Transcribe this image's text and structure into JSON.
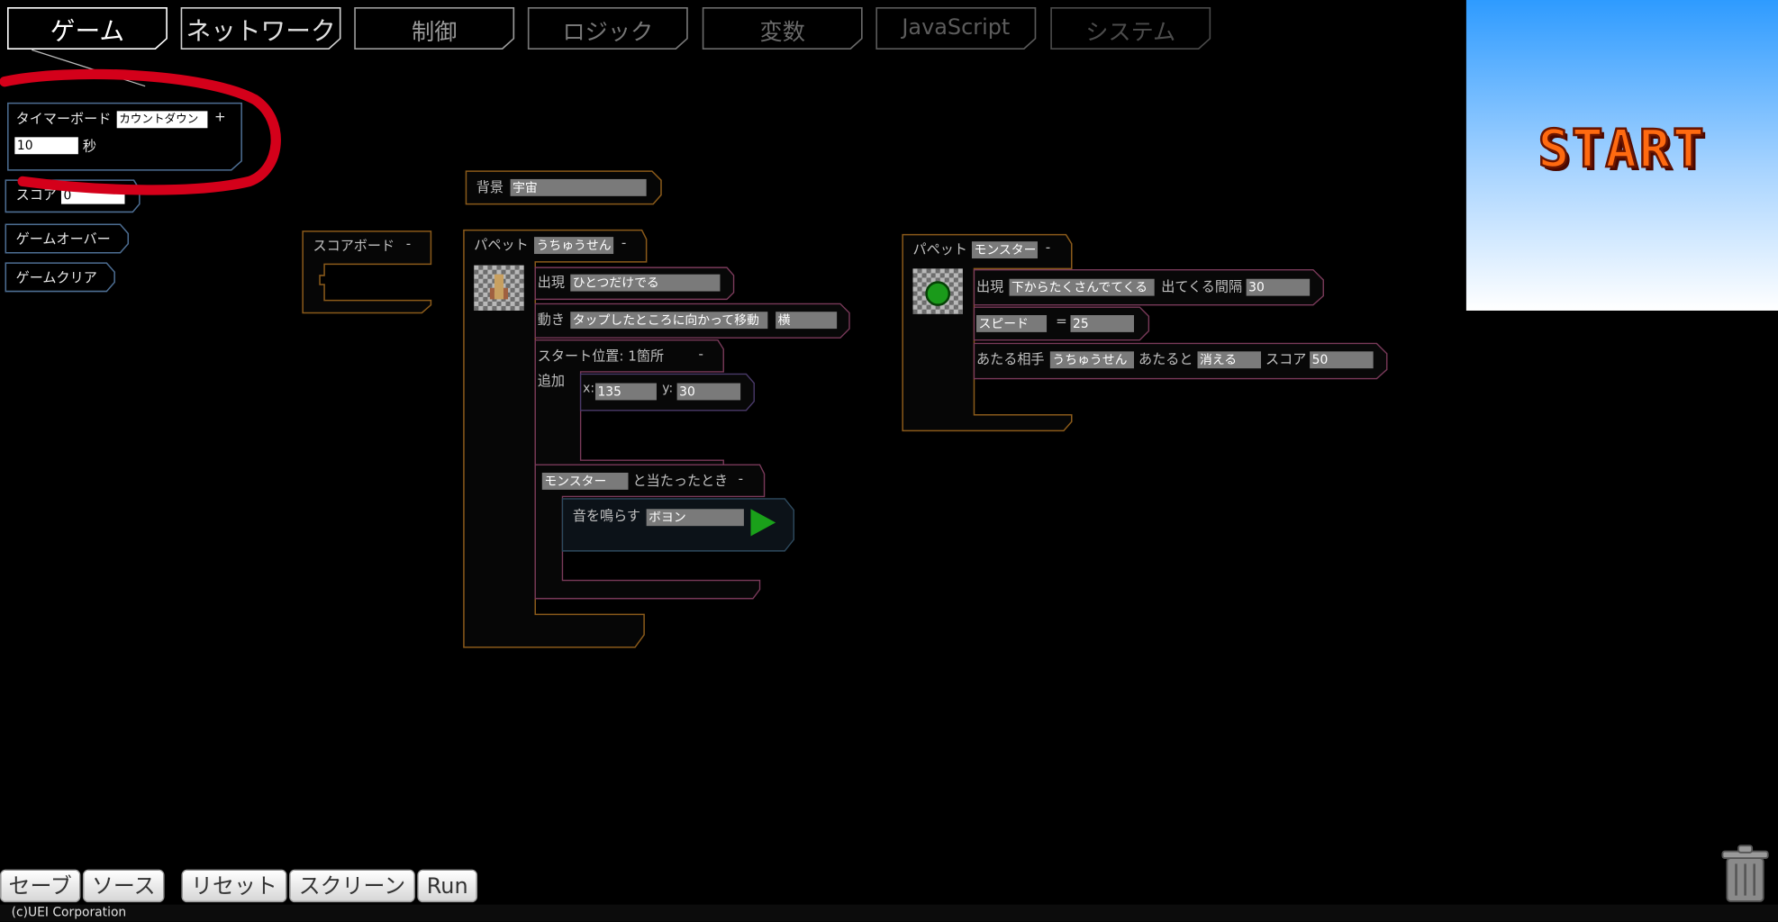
{
  "tabs": [
    "ゲーム",
    "ネットワーク",
    "制御",
    "ロジック",
    "変数",
    "JavaScript",
    "システム"
  ],
  "palette": {
    "timer": {
      "label": "タイマーボード",
      "mode": "カウントダウン",
      "plus": "+",
      "value": "10",
      "unit": "秒"
    },
    "score": {
      "label": "スコア",
      "value": "0"
    },
    "gameover": "ゲームオーバー",
    "gameclear": "ゲームクリア"
  },
  "scoreboard": {
    "label": "スコアボード",
    "minus": "-"
  },
  "background": {
    "label": "背景",
    "value": "宇宙"
  },
  "puppet1": {
    "label": "パペット",
    "name": "うちゅうせん",
    "minus": "-",
    "appear_label": "出現",
    "appear_value": "ひとつだけでる",
    "move_label": "動き",
    "move_value": "タップしたところに向かって移動",
    "move_dir": "横",
    "start_label": "スタート位置: 1箇所",
    "start_minus": "-",
    "add_label": "追加",
    "x_label": "x:",
    "x_value": "135",
    "y_label": "y:",
    "y_value": "30",
    "hit_target": "モンスター",
    "hit_label": "と当たったとき",
    "hit_minus": "-",
    "sound_label": "音を鳴らす",
    "sound_value": "ボヨン"
  },
  "puppet2": {
    "label": "パペット",
    "name": "モンスター",
    "minus": "-",
    "appear_label": "出現",
    "appear_value": "下からたくさんでてくる",
    "interval_label": "出てくる間隔",
    "interval_value": "30",
    "speed_label": "スピード",
    "speed_eq": "=",
    "speed_value": "25",
    "target_label": "あたる相手",
    "target_value": "うちゅうせん",
    "on_hit_label": "あたると",
    "on_hit_value": "消える",
    "score_label": "スコア",
    "score_value": "50"
  },
  "preview": {
    "start_text": "START"
  },
  "bottom": {
    "save": "セーブ",
    "source": "ソース",
    "reset": "リセット",
    "screen": "スクリーン",
    "run": "Run"
  },
  "footer": "(c)UEI Corporation",
  "colors": {
    "accent_tab_active": "#ffffff",
    "block_game": "#8a5a1a",
    "block_palette": "#3a5a7a",
    "annotation": "#d4001a",
    "preview_top": "#2e9bff"
  }
}
